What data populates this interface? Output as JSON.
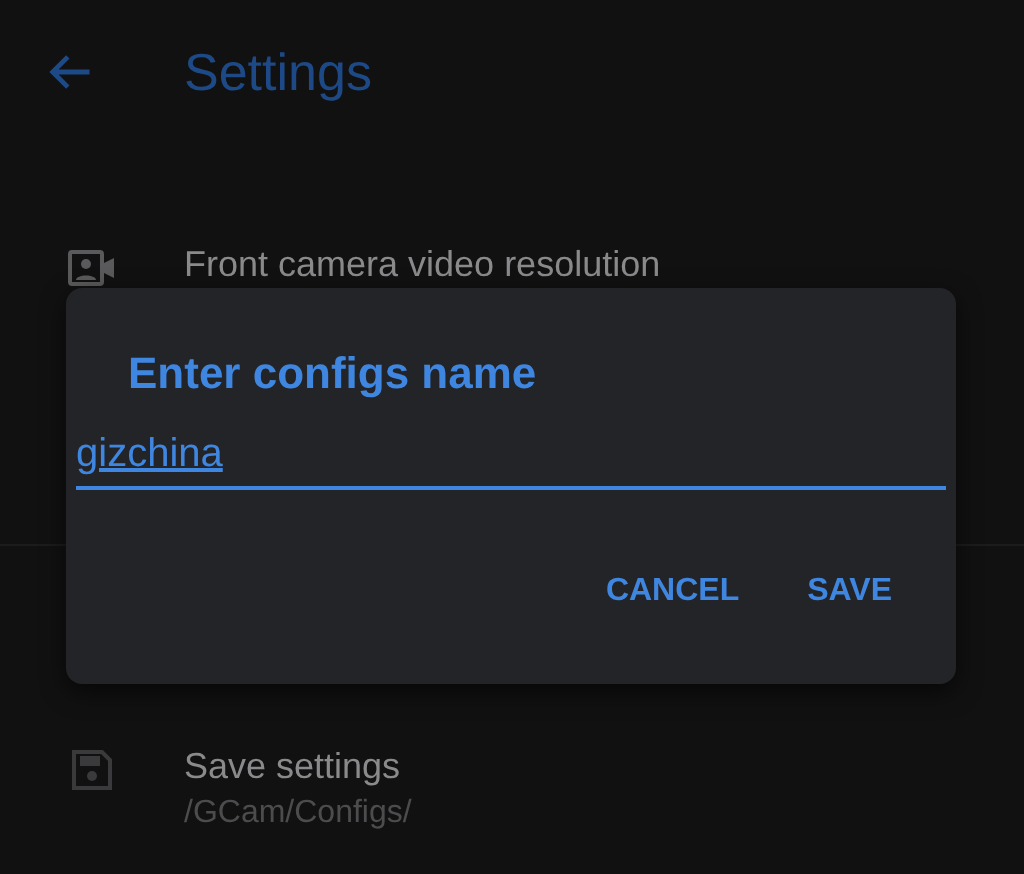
{
  "header": {
    "title": "Settings"
  },
  "settings": [
    {
      "kind": "video",
      "title": "Front camera video resolution"
    },
    {
      "kind": "save",
      "title": "Save settings",
      "subtitle": "/GCam/Configs/"
    }
  ],
  "dialog": {
    "title": "Enter configs name",
    "value": "gizchina",
    "buttons": [
      "CANCEL",
      "SAVE"
    ]
  }
}
